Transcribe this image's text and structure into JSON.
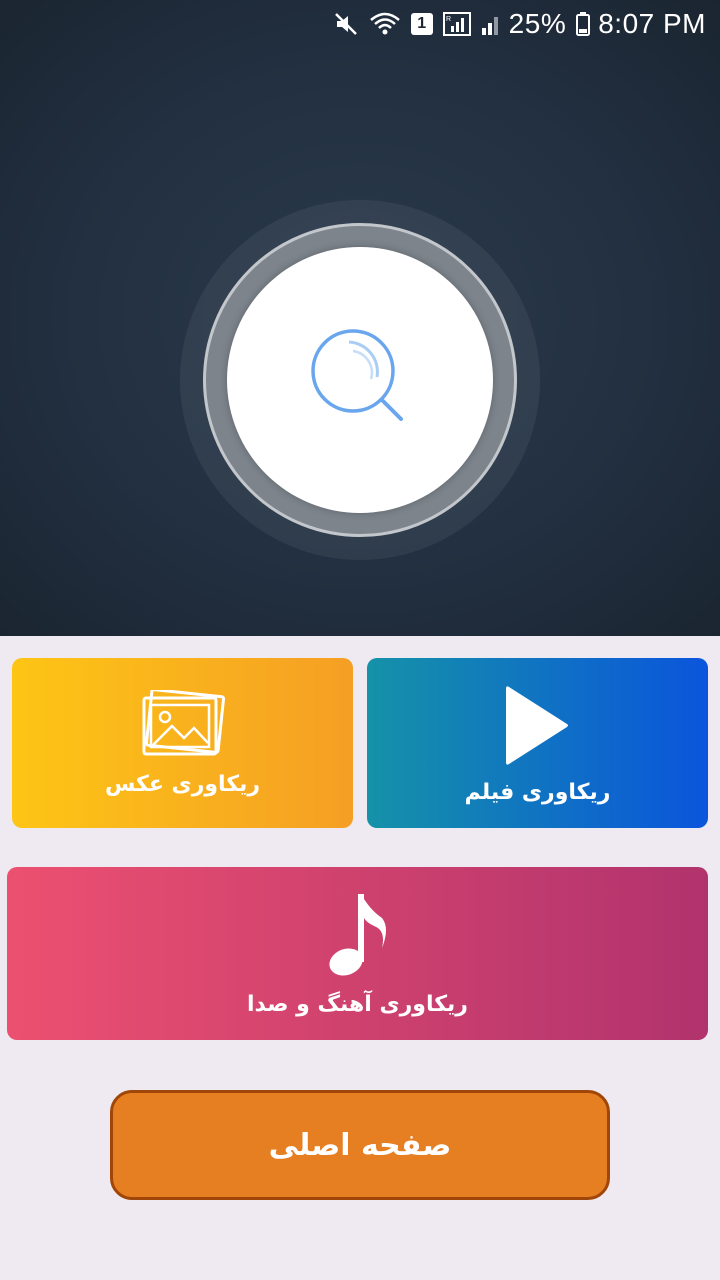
{
  "status_bar": {
    "battery_percent": "25%",
    "time": "8:07 PM",
    "sim_slot": "1",
    "icons": [
      "mute-icon",
      "wifi-icon",
      "sim-icon",
      "signal-icon",
      "signal-weak-icon",
      "battery-icon"
    ]
  },
  "scanner": {
    "icon": "search-icon",
    "accent_color": "#6aa6ee"
  },
  "cards": {
    "photo": {
      "label": "ریکاوری عکس",
      "icon": "photo-gallery-icon",
      "color_start": "#fdc515",
      "color_end": "#f59f24"
    },
    "video": {
      "label": "ریکاوری فیلم",
      "icon": "play-icon",
      "color_start": "#1592a8",
      "color_end": "#0b55dc"
    },
    "music": {
      "label": "ریکاوری آهنگ و صدا",
      "icon": "music-note-icon",
      "color_start": "#ec5070",
      "color_end": "#b1336d"
    }
  },
  "home_button": {
    "label": "صفحه اصلی",
    "color": "#e67e22"
  }
}
